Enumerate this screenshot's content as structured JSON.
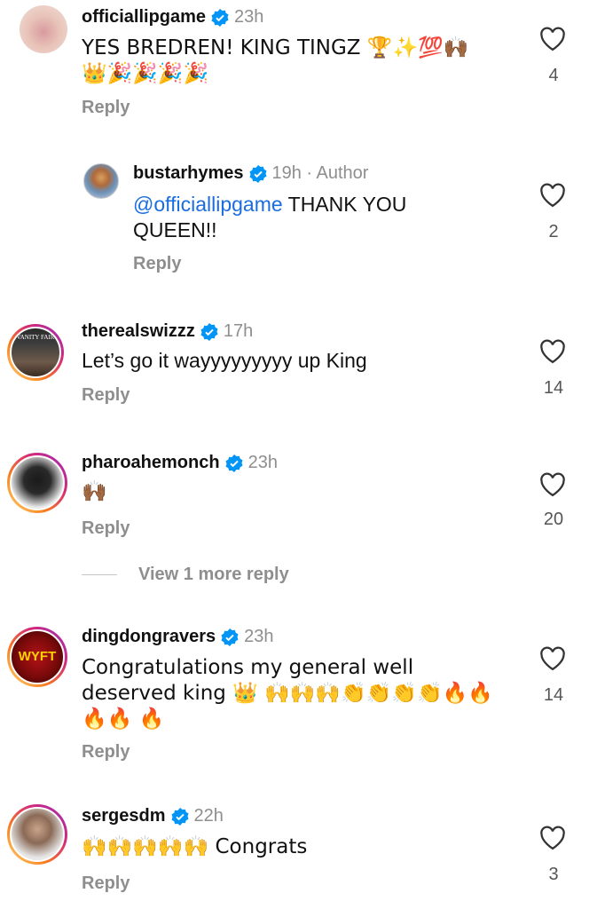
{
  "comments": [
    {
      "username": "officiallipgame",
      "time": "23h",
      "text": "YES BREDREN! KING TINGZ 🏆✨💯🙌🏾 👑🎉🎉🎉🎉",
      "reply": "Reply",
      "likes": "4"
    },
    {
      "username": "bustarhymes",
      "time": "19h · Author",
      "mention": "@officiallipgame",
      "text": " THANK YOU QUEEN!!",
      "reply": "Reply",
      "likes": "2"
    },
    {
      "username": "therealswizzz",
      "time": "17h",
      "text": "Let’s go it wayyyyyyyyy up King",
      "reply": "Reply",
      "likes": "14"
    },
    {
      "username": "pharoahemonch",
      "time": "23h",
      "text": "🙌🏾",
      "reply": "Reply",
      "likes": "20"
    },
    {
      "username": "dingdongravers",
      "time": "23h",
      "text": "Congratulations my general well deserved king 👑 🙌🙌🙌👏👏👏👏🔥🔥🔥🔥 🔥",
      "reply": "Reply",
      "likes": "14"
    },
    {
      "username": "sergesdm",
      "time": "22h",
      "text": "🙌🙌🙌🙌🙌 Congrats",
      "reply": "Reply",
      "likes": "3"
    }
  ],
  "view_more": "View 1 more reply",
  "avatar_logos": {
    "c2": "VANITY FAIR",
    "c4": "WYFT"
  },
  "colors": {
    "verified": "#0095f6",
    "mention": "#1a6de0",
    "secondary": "#8e8e8e"
  }
}
